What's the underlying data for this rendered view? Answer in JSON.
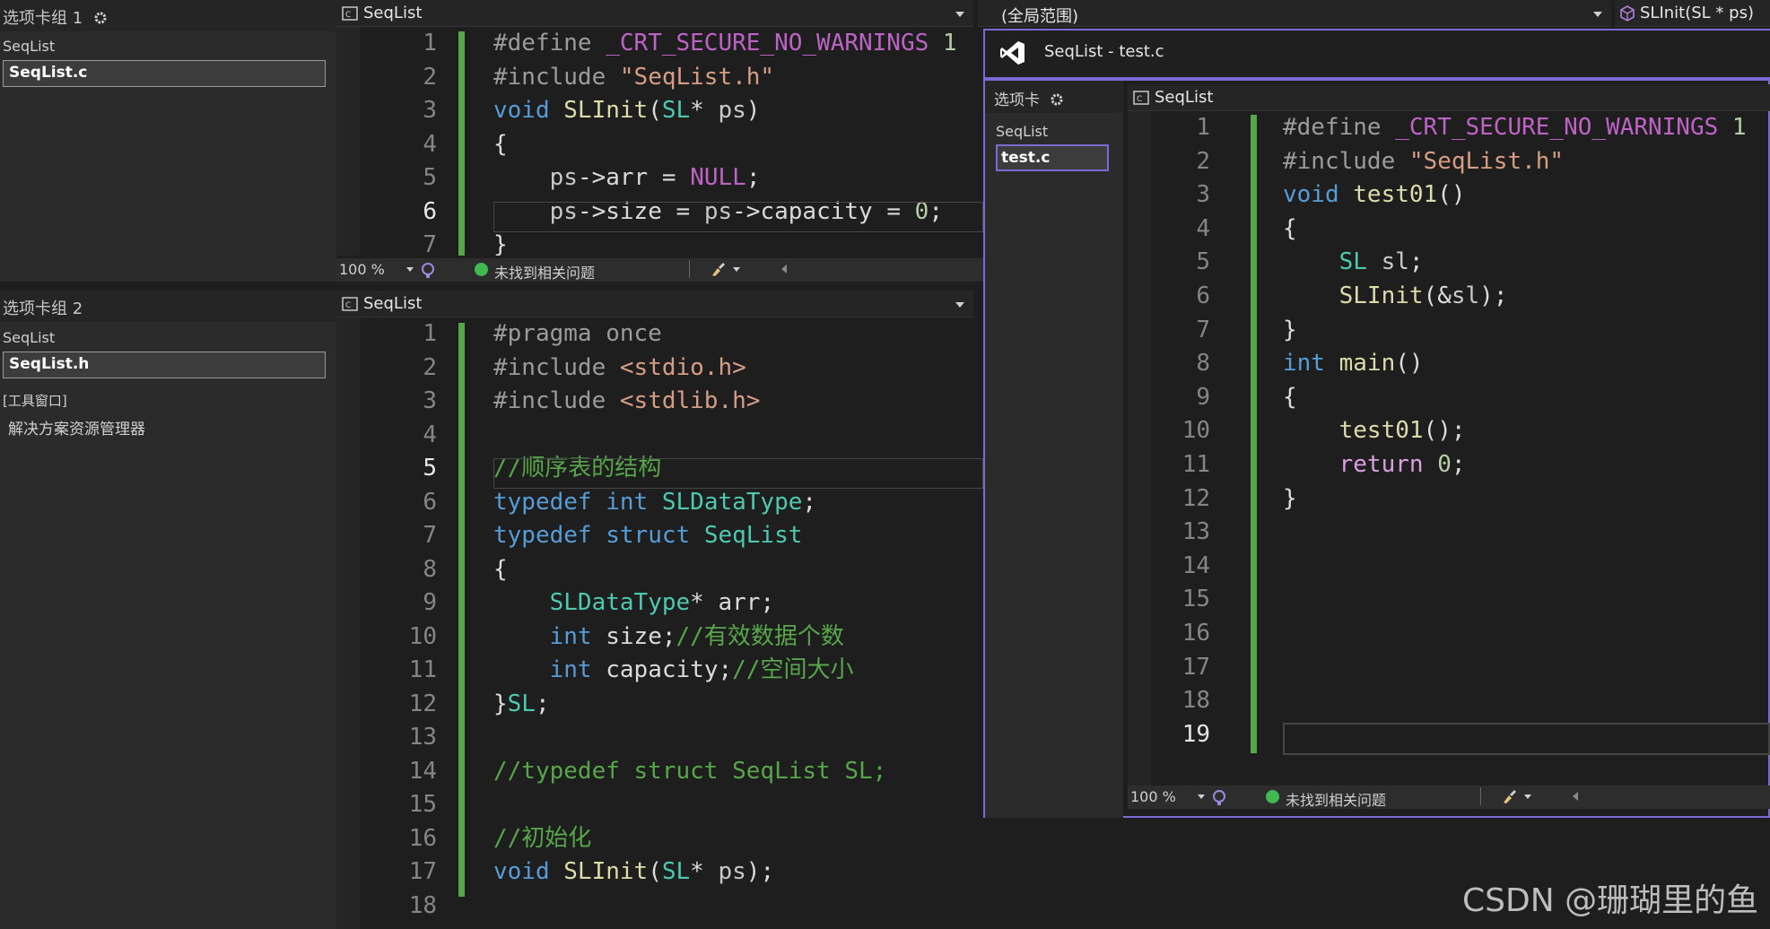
{
  "left_panel": {
    "group1": {
      "title": "选项卡组 1",
      "project": "SeqList",
      "file": "SeqList.c"
    },
    "group2": {
      "title": "选项卡组 2",
      "project": "SeqList",
      "file": "SeqList.h"
    },
    "tool_windows_header": "[工具窗口]",
    "tool_windows_item": "解决方案资源管理器"
  },
  "top_editor": {
    "project_dropdown": "SeqList",
    "scope_dropdown": "(全局范围)",
    "member_dropdown": "SLInit(SL * ps)",
    "zoom": "100 %",
    "status_text": "未找到相关问题",
    "line_numbers": [
      "1",
      "2",
      "3",
      "4",
      "5",
      "6",
      "7"
    ],
    "lines": [
      [
        [
          "pp",
          "#define "
        ],
        [
          "mac",
          "_CRT_SECURE_NO_WARNINGS"
        ],
        [
          "plain",
          " "
        ],
        [
          "num",
          "1"
        ]
      ],
      [
        [
          "pp",
          "#include "
        ],
        [
          "str",
          "\"SeqList.h\""
        ]
      ],
      [
        [
          "kw",
          "void "
        ],
        [
          "fn",
          "SLInit"
        ],
        [
          "plain",
          "("
        ],
        [
          "ty",
          "SL"
        ],
        [
          "plain",
          "* "
        ],
        [
          "var",
          "ps"
        ],
        [
          "plain",
          ")"
        ]
      ],
      [
        [
          "plain",
          "{"
        ]
      ],
      [
        [
          "plain",
          "    "
        ],
        [
          "var",
          "ps"
        ],
        [
          "plain",
          "->"
        ],
        [
          "mem",
          "arr"
        ],
        [
          "plain",
          " = "
        ],
        [
          "mac",
          "NULL"
        ],
        [
          "plain",
          ";"
        ]
      ],
      [
        [
          "plain",
          "    "
        ],
        [
          "var",
          "ps"
        ],
        [
          "plain",
          "->"
        ],
        [
          "mem",
          "size"
        ],
        [
          "plain",
          " = "
        ],
        [
          "var",
          "ps"
        ],
        [
          "plain",
          "->"
        ],
        [
          "mem",
          "capacity"
        ],
        [
          "plain",
          " = "
        ],
        [
          "num",
          "0"
        ],
        [
          "plain",
          ";"
        ]
      ],
      [
        [
          "plain",
          "}"
        ]
      ]
    ]
  },
  "bottom_editor": {
    "project_dropdown": "SeqList",
    "line_numbers": [
      "1",
      "2",
      "3",
      "4",
      "5",
      "6",
      "7",
      "8",
      "9",
      "10",
      "11",
      "12",
      "13",
      "14",
      "15",
      "16",
      "17",
      "18"
    ],
    "lines": [
      [
        [
          "pp",
          "#pragma once"
        ]
      ],
      [
        [
          "pp",
          "#include "
        ],
        [
          "str",
          "<stdio.h>"
        ]
      ],
      [
        [
          "pp",
          "#include "
        ],
        [
          "str",
          "<stdlib.h>"
        ]
      ],
      [],
      [
        [
          "cmt",
          "//顺序表的结构"
        ]
      ],
      [
        [
          "kw",
          "typedef "
        ],
        [
          "kw",
          "int "
        ],
        [
          "ty",
          "SLDataType"
        ],
        [
          "plain",
          ";"
        ]
      ],
      [
        [
          "kw",
          "typedef "
        ],
        [
          "kw",
          "struct "
        ],
        [
          "ty",
          "SeqList"
        ]
      ],
      [
        [
          "plain",
          "{"
        ]
      ],
      [
        [
          "plain",
          "    "
        ],
        [
          "ty",
          "SLDataType"
        ],
        [
          "plain",
          "* "
        ],
        [
          "mem",
          "arr"
        ],
        [
          "plain",
          ";"
        ]
      ],
      [
        [
          "plain",
          "    "
        ],
        [
          "kw",
          "int "
        ],
        [
          "mem",
          "size"
        ],
        [
          "plain",
          ";"
        ],
        [
          "cmt",
          "//有效数据个数"
        ]
      ],
      [
        [
          "plain",
          "    "
        ],
        [
          "kw",
          "int "
        ],
        [
          "mem",
          "capacity"
        ],
        [
          "plain",
          ";"
        ],
        [
          "cmt",
          "//空间大小"
        ]
      ],
      [
        [
          "plain",
          "}"
        ],
        [
          "ty",
          "SL"
        ],
        [
          "plain",
          ";"
        ]
      ],
      [],
      [
        [
          "cmt",
          "//typedef struct SeqList SL;"
        ]
      ],
      [],
      [
        [
          "cmt",
          "//初始化"
        ]
      ],
      [
        [
          "kw",
          "void "
        ],
        [
          "fn",
          "SLInit"
        ],
        [
          "plain",
          "("
        ],
        [
          "ty",
          "SL"
        ],
        [
          "plain",
          "* "
        ],
        [
          "var",
          "ps"
        ],
        [
          "plain",
          ");"
        ]
      ],
      []
    ]
  },
  "float_window": {
    "title": "SeqList - test.c",
    "tab_group": "选项卡",
    "project": "SeqList",
    "file": "test.c",
    "project_dropdown": "SeqList",
    "zoom": "100 %",
    "status_text": "未找到相关问题",
    "line_numbers": [
      "1",
      "2",
      "3",
      "4",
      "5",
      "6",
      "7",
      "8",
      "9",
      "10",
      "11",
      "12",
      "13",
      "14",
      "15",
      "16",
      "17",
      "18",
      "19"
    ],
    "lines": [
      [
        [
          "pp",
          "#define "
        ],
        [
          "mac",
          "_CRT_SECURE_NO_WARNINGS"
        ],
        [
          "plain",
          " "
        ],
        [
          "num",
          "1"
        ]
      ],
      [
        [
          "pp",
          "#include "
        ],
        [
          "str",
          "\"SeqList.h\""
        ]
      ],
      [
        [
          "kw",
          "void "
        ],
        [
          "fn",
          "test01"
        ],
        [
          "plain",
          "()"
        ]
      ],
      [
        [
          "plain",
          "{"
        ]
      ],
      [
        [
          "plain",
          "    "
        ],
        [
          "ty",
          "SL "
        ],
        [
          "var",
          "sl"
        ],
        [
          "plain",
          ";"
        ]
      ],
      [
        [
          "plain",
          "    "
        ],
        [
          "fn",
          "SLInit"
        ],
        [
          "plain",
          "(&"
        ],
        [
          "var",
          "sl"
        ],
        [
          "plain",
          ");"
        ]
      ],
      [
        [
          "plain",
          "}"
        ]
      ],
      [
        [
          "kw",
          "int "
        ],
        [
          "fn",
          "main"
        ],
        [
          "plain",
          "()"
        ]
      ],
      [
        [
          "plain",
          "{"
        ]
      ],
      [
        [
          "plain",
          "    "
        ],
        [
          "fn",
          "test01"
        ],
        [
          "plain",
          "();"
        ]
      ],
      [
        [
          "plain",
          "    "
        ],
        [
          "ctl",
          "return "
        ],
        [
          "num",
          "0"
        ],
        [
          "plain",
          ";"
        ]
      ],
      [
        [
          "plain",
          "}"
        ]
      ],
      [],
      [],
      [],
      [],
      [],
      [],
      []
    ]
  },
  "watermark": "CSDN @珊瑚里的鱼",
  "colors": {
    "background": "#1e1e1e",
    "keyword": "#569cd6",
    "type": "#4ec9b0",
    "function": "#dcdcaa",
    "comment": "#57a64a",
    "string": "#d69d85",
    "macro": "#bd63c5",
    "number": "#b5cea8",
    "change_bar": "#57a64a",
    "window_border": "#7a6ad6"
  },
  "icons": [
    "gear-icon",
    "file-c-icon",
    "vs-logo-icon",
    "class-member-icon",
    "status-ok-icon",
    "brush-icon",
    "spell-icon"
  ]
}
